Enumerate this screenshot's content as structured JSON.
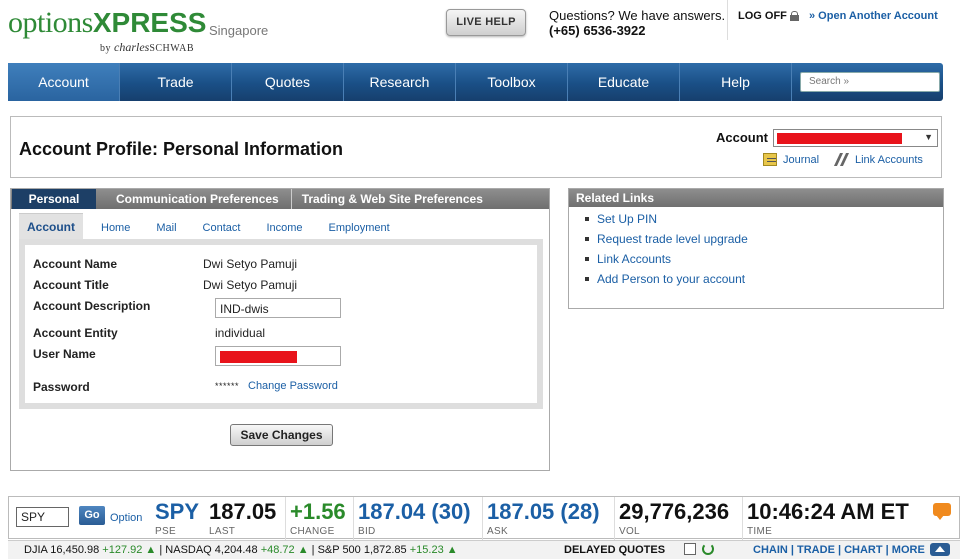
{
  "header": {
    "logo_text": "options",
    "logo_bold": "XPRESS",
    "logo_by": "by",
    "logo_sub": "charles",
    "logo_sub2": "SCHWAB",
    "region": "Singapore",
    "live_help": "LIVE HELP",
    "questions": "Questions? We have answers.",
    "phone": "(+65) 6536-3922",
    "log_off": "LOG OFF",
    "open_account": "» Open Another Account"
  },
  "nav": {
    "items": [
      "Account",
      "Trade",
      "Quotes",
      "Research",
      "Toolbox",
      "Educate",
      "Help"
    ],
    "search_placeholder": "Search »"
  },
  "profile": {
    "title": "Account Profile: Personal Information",
    "account_label": "Account",
    "journal": "Journal",
    "link_accounts": "Link Accounts"
  },
  "tabs": {
    "main": [
      "Personal",
      "Communication Preferences",
      "Trading & Web Site Preferences"
    ],
    "sub": [
      "Account",
      "Home",
      "Mail",
      "Contact",
      "Income",
      "Employment"
    ]
  },
  "form": {
    "account_name_label": "Account Name",
    "account_name_value": "Dwi Setyo Pamuji",
    "account_title_label": "Account Title",
    "account_title_value": "Dwi Setyo Pamuji",
    "account_description_label": "Account Description",
    "account_description_value": "IND-dwis",
    "account_entity_label": "Account Entity",
    "account_entity_value": "individual",
    "user_name_label": "User Name",
    "password_label": "Password",
    "password_mask": "******",
    "change_password": "Change Password",
    "save_changes": "Save Changes"
  },
  "related": {
    "title": "Related Links",
    "links": [
      "Set Up PIN",
      "Request trade level upgrade",
      "Link Accounts",
      "Add Person to your account"
    ]
  },
  "quote": {
    "symbol_input": "SPY",
    "go": "Go",
    "option": "Option",
    "symbol": "SPY",
    "exchange": "PSE",
    "last": "187.05",
    "last_label": "LAST",
    "change": "+1.56",
    "change_label": "CHANGE",
    "bid": "187.04 (30)",
    "bid_label": "BID",
    "ask": "187.05 (28)",
    "ask_label": "ASK",
    "vol": "29,776,236",
    "vol_label": "VOL",
    "time": "10:46:24 AM ET",
    "time_label": "TIME"
  },
  "ticker": {
    "djia": "DJIA 16,450.98",
    "djia_chg": "+127.92 ▲",
    "nasdaq": "| NASDAQ 4,204.48",
    "nasdaq_chg": "+48.72 ▲",
    "sp": "| S&P 500 1,872.85",
    "sp_chg": "+15.23 ▲",
    "delayed": "DELAYED QUOTES",
    "links": "CHAIN | TRADE | CHART | MORE"
  }
}
